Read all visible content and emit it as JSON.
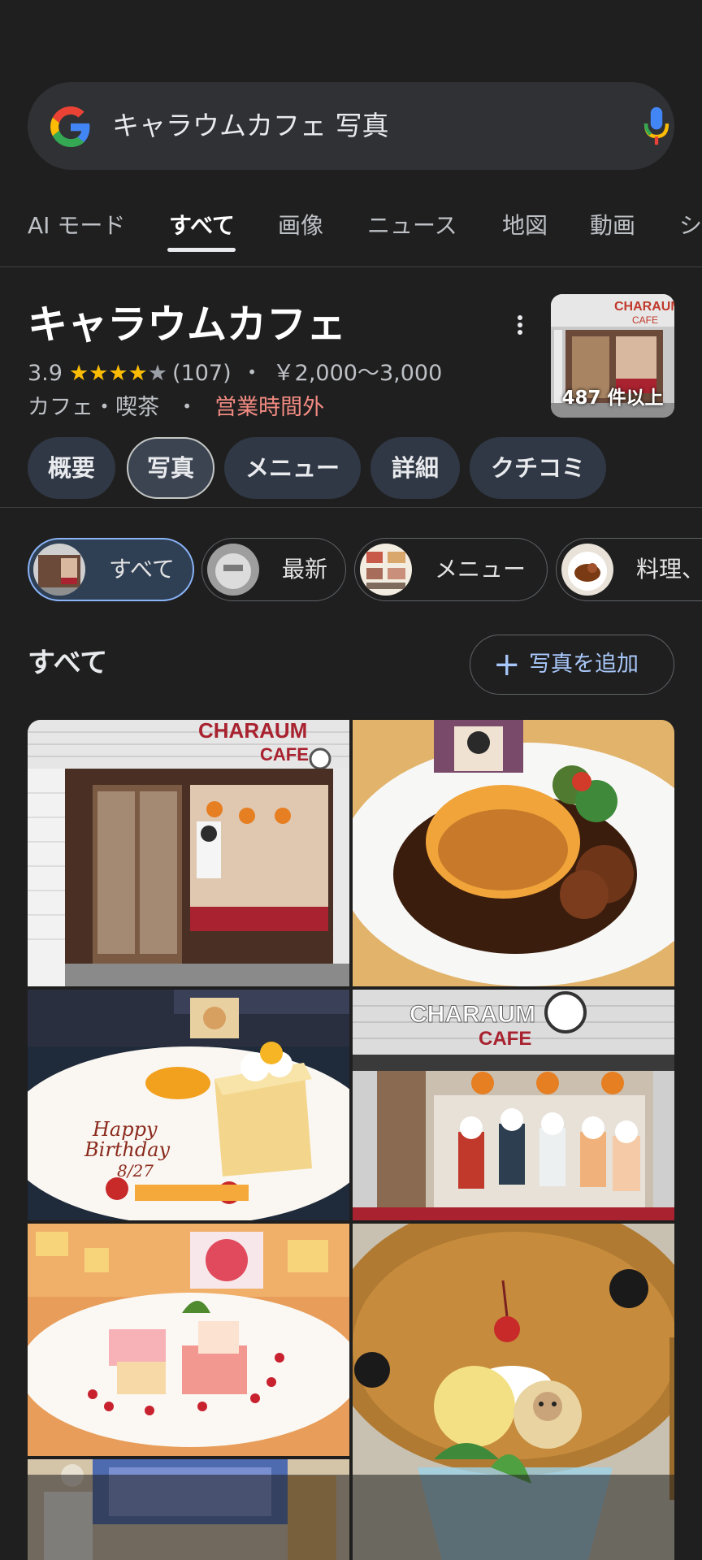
{
  "search": {
    "query": "キャラウムカフェ 写真"
  },
  "tabs": [
    {
      "label": "AI モード"
    },
    {
      "label": "すべて",
      "active": true
    },
    {
      "label": "画像"
    },
    {
      "label": "ニュース"
    },
    {
      "label": "地図"
    },
    {
      "label": "動画"
    },
    {
      "label": "シ"
    }
  ],
  "business": {
    "name": "キャラウムカフェ",
    "rating": "3.9",
    "rating_value": 3.9,
    "reviews": "(107)",
    "separator": "・",
    "price": "￥2,000～3,000",
    "category": "カフェ・喫茶",
    "status": "営業時間外",
    "photo_count": "487 件以上"
  },
  "chips": [
    {
      "label": "概要"
    },
    {
      "label": "写真",
      "active": true
    },
    {
      "label": "メニュー"
    },
    {
      "label": "詳細"
    },
    {
      "label": "クチコミ"
    }
  ],
  "filters": [
    {
      "label": "すべて",
      "active": true
    },
    {
      "label": "最新"
    },
    {
      "label": "メニュー"
    },
    {
      "label": "料理、"
    }
  ],
  "section": {
    "title": "すべて",
    "add_photo_label": "写真を追加"
  },
  "colors": {
    "background": "#1f1f1f",
    "search_bg": "#303134",
    "star": "#fbbc04",
    "closed": "#f28b82",
    "link_blue": "#a8c7fa"
  }
}
